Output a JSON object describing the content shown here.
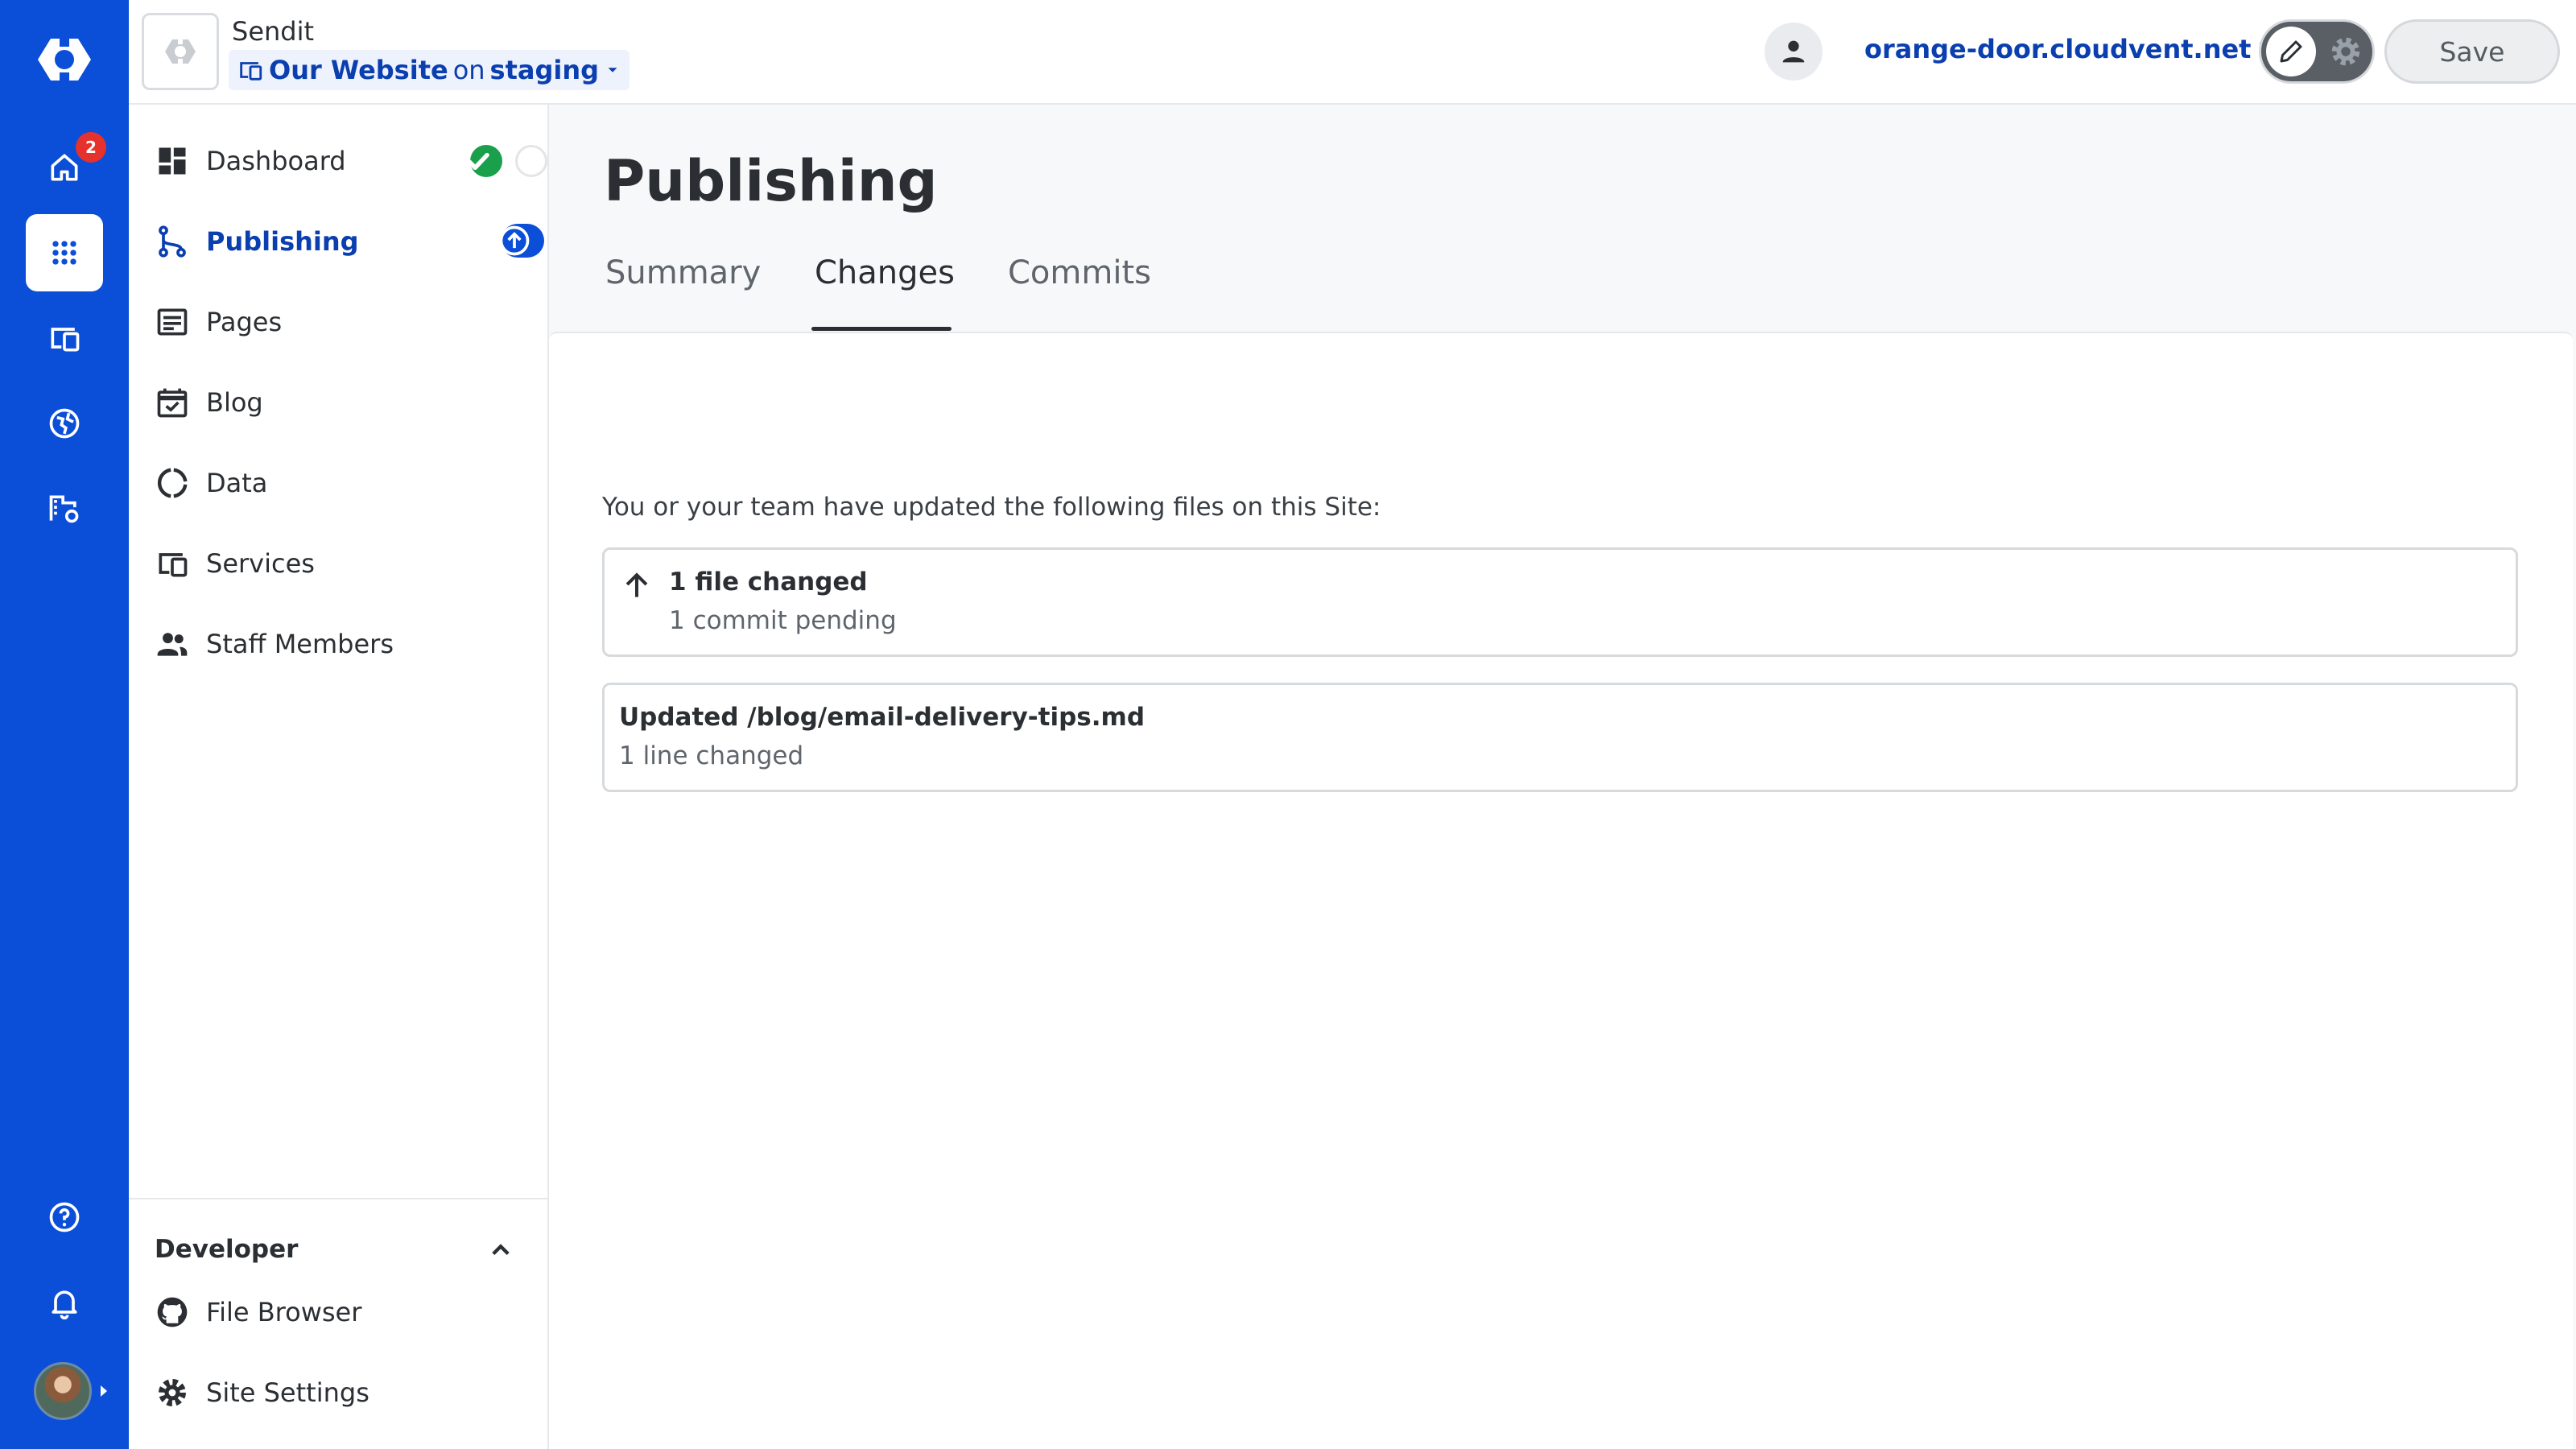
{
  "colors": {
    "rail_background": "#0b4ed8",
    "accent": "#0b3fb0",
    "success": "#1aa04a",
    "badge": "#e5322d"
  },
  "rail": {
    "logo_icon": "brand-logo-icon",
    "items": [
      {
        "icon": "home-icon",
        "badge": "2"
      },
      {
        "icon": "apps-grid-icon",
        "active": true
      },
      {
        "icon": "devices-icon"
      },
      {
        "icon": "globe-icon"
      },
      {
        "icon": "building-settings-icon"
      }
    ],
    "bottom_items": [
      {
        "icon": "help-icon"
      },
      {
        "icon": "bell-icon"
      },
      {
        "icon": "user-avatar"
      }
    ]
  },
  "header": {
    "org_name": "Sendit",
    "site_name": "Our Website",
    "site_on": "on",
    "branch": "staging",
    "domain": "orange-door.cloudvent.net",
    "save_label": "Save"
  },
  "sidebar": {
    "items": [
      {
        "label": "Dashboard",
        "icon": "dashboard-icon"
      },
      {
        "label": "Publishing",
        "icon": "branch-icon",
        "active": true
      },
      {
        "label": "Pages",
        "icon": "pages-icon"
      },
      {
        "label": "Blog",
        "icon": "calendar-check-icon"
      },
      {
        "label": "Data",
        "icon": "data-icon"
      },
      {
        "label": "Services",
        "icon": "services-icon"
      },
      {
        "label": "Staff Members",
        "icon": "people-icon"
      }
    ],
    "developer": {
      "title": "Developer",
      "items": [
        {
          "label": "File Browser",
          "icon": "github-icon"
        },
        {
          "label": "Site Settings",
          "icon": "gear-icon"
        }
      ]
    }
  },
  "main": {
    "title": "Publishing",
    "tabs": [
      {
        "label": "Summary"
      },
      {
        "label": "Changes",
        "active": true
      },
      {
        "label": "Commits"
      }
    ],
    "intro": "You or your team have updated the following files on this Site:",
    "summary_card": {
      "title": "1 file changed",
      "subtitle": "1 commit pending"
    },
    "file_card": {
      "title": "Updated /blog/email-delivery-tips.md",
      "subtitle": "1 line changed"
    }
  }
}
